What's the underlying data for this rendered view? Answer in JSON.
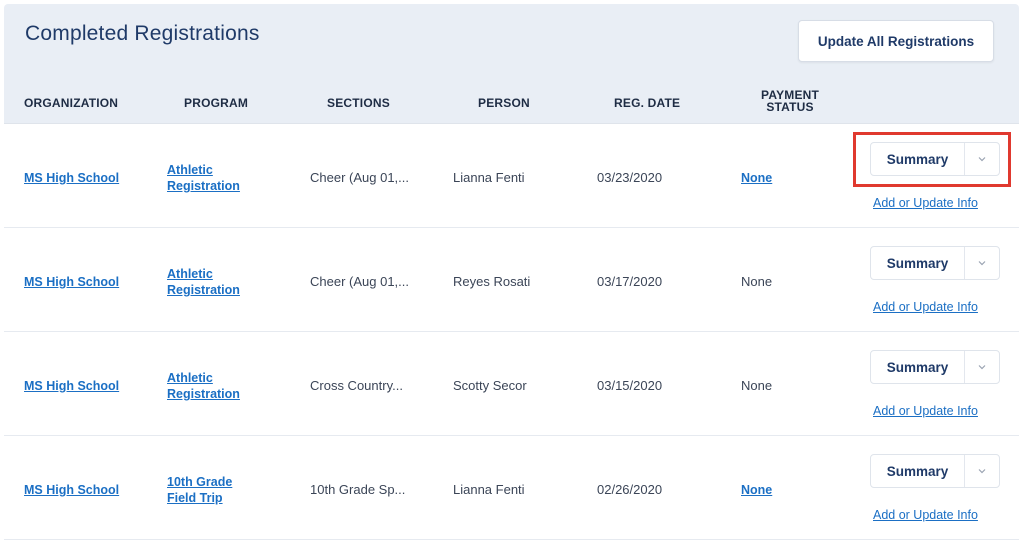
{
  "header": {
    "title": "Completed Registrations",
    "update_all_label": "Update All Registrations"
  },
  "columns": {
    "organization": "ORGANIZATION",
    "program": "PROGRAM",
    "sections": "SECTIONS",
    "person": "PERSON",
    "reg_date": "REG. DATE",
    "payment_status_line1": "PAYMENT",
    "payment_status_line2": "STATUS"
  },
  "rows": [
    {
      "organization": "MS High School",
      "program_line1": "Athletic",
      "program_line2": "Registration",
      "sections": "Cheer (Aug 01,...",
      "person": "Lianna Fenti",
      "reg_date": "03/23/2020",
      "payment_status": "None",
      "payment_is_link": true,
      "summary_label": "Summary",
      "add_update_label": "Add or Update Info"
    },
    {
      "organization": "MS High School",
      "program_line1": "Athletic",
      "program_line2": "Registration",
      "sections": "Cheer (Aug 01,...",
      "person": "Reyes Rosati",
      "reg_date": "03/17/2020",
      "payment_status": "None",
      "payment_is_link": false,
      "summary_label": "Summary",
      "add_update_label": "Add or Update Info"
    },
    {
      "organization": "MS High School",
      "program_line1": "Athletic",
      "program_line2": "Registration",
      "sections": "Cross Country...",
      "person": "Scotty Secor",
      "reg_date": "03/15/2020",
      "payment_status": "None",
      "payment_is_link": false,
      "summary_label": "Summary",
      "add_update_label": "Add or Update Info"
    },
    {
      "organization": "MS High School",
      "program_line1": "10th Grade",
      "program_line2": "Field Trip",
      "sections": "10th Grade Sp...",
      "person": "Lianna Fenti",
      "reg_date": "02/26/2020",
      "payment_status": "None",
      "payment_is_link": true,
      "summary_label": "Summary",
      "add_update_label": "Add or Update Info"
    }
  ],
  "colors": {
    "link": "#1b6fc4",
    "header_bg": "#e9eef5",
    "highlight": "#e0392f",
    "title": "#1f3a68"
  },
  "icons": {
    "dropdown": "chevron-down-icon"
  }
}
